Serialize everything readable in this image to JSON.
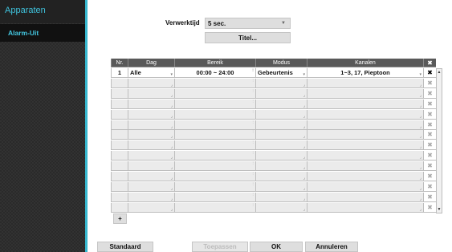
{
  "sidebar": {
    "header": "Apparaten",
    "items": [
      {
        "label": "Alarm-Uit",
        "selected": true
      }
    ],
    "accent_color": "#37b7cf"
  },
  "settings": {
    "dwell_label": "Verwerktijd",
    "dwell_value": "5 sec.",
    "title_button": "Titel..."
  },
  "table": {
    "headers": {
      "nr": "Nr.",
      "day": "Dag",
      "range": "Bereik",
      "mode": "Modus",
      "channels": "Kanalen",
      "delete": "✖"
    },
    "rows": [
      {
        "nr": "1",
        "day": "Alle",
        "range": "00:00 ~ 24:00",
        "mode": "Gebeurtenis",
        "channels": "1~3, 17, Pieptoon",
        "delete": "✖"
      },
      {
        "nr": "",
        "day": "",
        "range": "",
        "mode": "",
        "channels": "",
        "delete": "✖"
      },
      {
        "nr": "",
        "day": "",
        "range": "",
        "mode": "",
        "channels": "",
        "delete": "✖"
      },
      {
        "nr": "",
        "day": "",
        "range": "",
        "mode": "",
        "channels": "",
        "delete": "✖"
      },
      {
        "nr": "",
        "day": "",
        "range": "",
        "mode": "",
        "channels": "",
        "delete": "✖"
      },
      {
        "nr": "",
        "day": "",
        "range": "",
        "mode": "",
        "channels": "",
        "delete": "✖"
      },
      {
        "nr": "",
        "day": "",
        "range": "",
        "mode": "",
        "channels": "",
        "delete": "✖"
      },
      {
        "nr": "",
        "day": "",
        "range": "",
        "mode": "",
        "channels": "",
        "delete": "✖"
      },
      {
        "nr": "",
        "day": "",
        "range": "",
        "mode": "",
        "channels": "",
        "delete": "✖"
      },
      {
        "nr": "",
        "day": "",
        "range": "",
        "mode": "",
        "channels": "",
        "delete": "✖"
      },
      {
        "nr": "",
        "day": "",
        "range": "",
        "mode": "",
        "channels": "",
        "delete": "✖"
      },
      {
        "nr": "",
        "day": "",
        "range": "",
        "mode": "",
        "channels": "",
        "delete": "✖"
      },
      {
        "nr": "",
        "day": "",
        "range": "",
        "mode": "",
        "channels": "",
        "delete": "✖"
      },
      {
        "nr": "",
        "day": "",
        "range": "",
        "mode": "",
        "channels": "",
        "delete": "✖"
      }
    ],
    "add_button": "+"
  },
  "buttons": {
    "default": "Standaard",
    "apply": "Toepassen",
    "ok": "OK",
    "cancel": "Annuleren"
  }
}
